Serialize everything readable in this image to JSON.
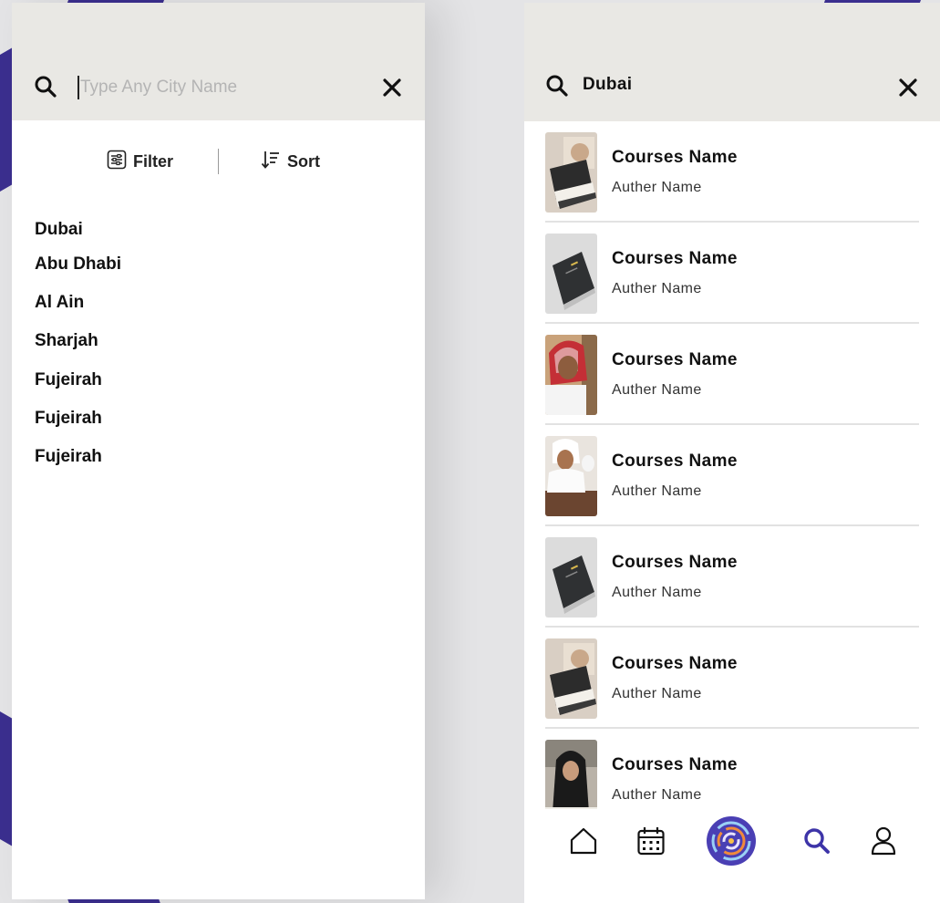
{
  "colors": {
    "accent": "#3b2f8f",
    "active_nav": "#3d34a8",
    "search_bar_bg": "#e9e8e4",
    "placeholder": "#b4b4b4"
  },
  "left_panel": {
    "search": {
      "placeholder": "Type Any City Name",
      "value": "",
      "search_icon": "search-icon",
      "clear_icon": "close-icon"
    },
    "toolbar": {
      "filter_label": "Filter",
      "filter_icon": "sliders-icon",
      "sort_label": "Sort",
      "sort_icon": "sort-icon"
    },
    "cities": [
      "Dubai",
      "Abu Dhabi",
      "Al Ain",
      "Sharjah",
      "Fujeirah",
      "Fujeirah",
      "Fujeirah"
    ]
  },
  "right_panel": {
    "search": {
      "value": "Dubai",
      "search_icon": "search-icon",
      "clear_icon": "close-icon"
    },
    "courses": [
      {
        "name": "Courses Name",
        "author": "Auther Name",
        "thumbnail": "books-stack-image"
      },
      {
        "name": "Courses Name",
        "author": "Auther Name",
        "thumbnail": "dark-book-image"
      },
      {
        "name": "Courses Name",
        "author": "Auther Name",
        "thumbnail": "student-red-headscarf-image"
      },
      {
        "name": "Courses Name",
        "author": "Auther Name",
        "thumbnail": "student-white-dress-image"
      },
      {
        "name": "Courses Name",
        "author": "Auther Name",
        "thumbnail": "dark-book-image"
      },
      {
        "name": "Courses Name",
        "author": "Auther Name",
        "thumbnail": "books-stack-image"
      },
      {
        "name": "Courses Name",
        "author": "Auther Name",
        "thumbnail": "student-hijab-image"
      }
    ],
    "bottom_nav": [
      {
        "name": "home",
        "icon": "home-icon",
        "active": false
      },
      {
        "name": "calendar",
        "icon": "calendar-icon",
        "active": false
      },
      {
        "name": "center",
        "icon": "app-logo-icon",
        "active": false
      },
      {
        "name": "search",
        "icon": "search-icon",
        "active": true
      },
      {
        "name": "profile",
        "icon": "user-icon",
        "active": false
      }
    ]
  }
}
